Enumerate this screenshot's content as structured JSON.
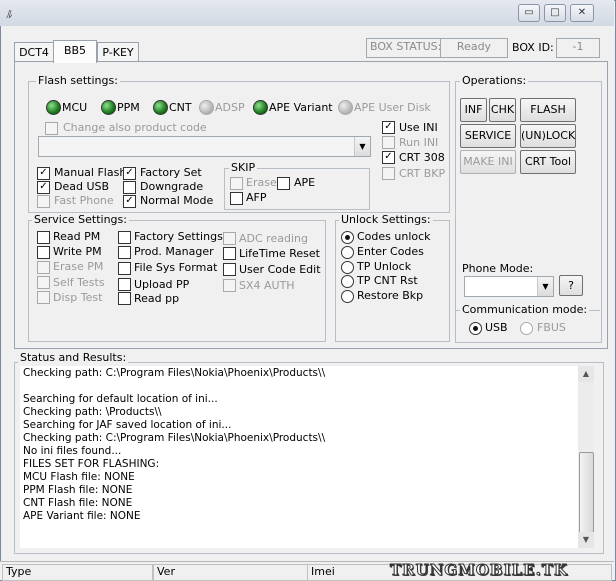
{
  "window": {
    "icon_glyph": "ﾙ",
    "min_glyph": "▭",
    "max_glyph": "□",
    "close_glyph": "✕"
  },
  "tabs": [
    "DCT4",
    "BB5",
    "P-KEY"
  ],
  "box_status": {
    "label": "BOX STATUS:",
    "value": "Ready",
    "id_label": "BOX ID:",
    "id_value": "-1"
  },
  "flash_settings": {
    "title": "Flash settings:",
    "leds": [
      {
        "label": "MCU",
        "on": true
      },
      {
        "label": "PPM",
        "on": true
      },
      {
        "label": "CNT",
        "on": true
      },
      {
        "label": "ADSP",
        "on": false
      },
      {
        "label": "APE Variant",
        "on": true
      },
      {
        "label": "APE User Disk",
        "on": false
      }
    ],
    "change_product_code": "Change also product code",
    "use_ini": "Use INI",
    "run_ini": "Run INI",
    "crt_308": "CRT 308",
    "crt_bkp": "CRT BKP",
    "manual_flash": "Manual Flash",
    "dead_usb": "Dead USB",
    "fast_phone": "Fast Phone",
    "factory_set": "Factory Set",
    "downgrade": "Downgrade",
    "normal_mode": "Normal Mode",
    "skip": {
      "title": "SKIP",
      "erase": "Erase",
      "ape": "APE",
      "afp": "AFP"
    }
  },
  "service_settings": {
    "title": "Service Settings:",
    "col1": [
      "Read PM",
      "Write PM",
      "Erase PM",
      "Self Tests",
      "Disp Test"
    ],
    "col2": [
      "Factory Settings",
      "Prod. Manager",
      "File Sys Format",
      "Upload PP",
      "Read pp"
    ],
    "col3": [
      "ADC reading",
      "LifeTime Reset",
      "User Code Edit",
      "SX4 AUTH"
    ]
  },
  "unlock_settings": {
    "title": "Unlock Settings:",
    "options": [
      "Codes unlock",
      "Enter Codes",
      "TP Unlock",
      "TP CNT Rst",
      "Restore Bkp"
    ]
  },
  "operations": {
    "title": "Operations:",
    "inf": "INF",
    "chk": "CHK",
    "flash": "FLASH",
    "service": "SERVICE",
    "unlock": "(UN)LOCK",
    "make_ini": "MAKE INI",
    "crt_tool": "CRT Tool",
    "phone_mode": "Phone Mode:",
    "help": "?",
    "comm_mode": "Communication mode:",
    "usb": "USB",
    "fbus": "FBUS"
  },
  "status": {
    "title": "Status and Results:",
    "lines": [
      "Checking path: C:\\Program Files\\Nokia\\Phoenix\\Products\\\\",
      "",
      "Searching for default location of ini...",
      "Checking path: \\Products\\\\",
      "Searching for JAF saved location of ini...",
      "Checking path: C:\\Program Files\\Nokia\\Phoenix\\Products\\\\",
      "No ini files found...",
      "FILES SET FOR FLASHING:",
      "MCU Flash file: NONE",
      "PPM Flash file: NONE",
      "CNT Flash file: NONE",
      "APE Variant file: NONE"
    ]
  },
  "statusbar": {
    "type": "Type",
    "ver": "Ver",
    "imei": "Imei"
  },
  "watermark": "TRUNGMOBILE.TK",
  "scroll": {
    "up": "▲",
    "down": "▼"
  }
}
